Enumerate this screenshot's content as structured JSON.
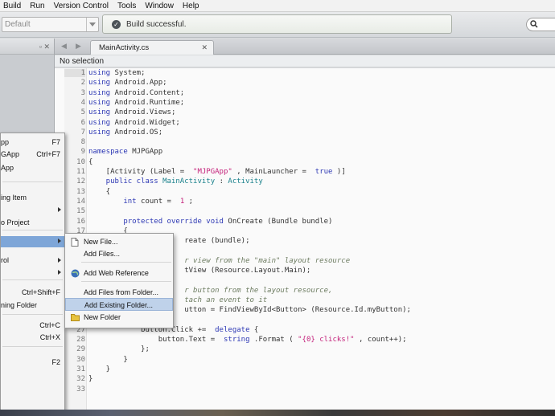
{
  "menubar": {
    "items": [
      "Build",
      "Run",
      "Version Control",
      "Tools",
      "Window",
      "Help"
    ]
  },
  "toolbar": {
    "config_value": "Default",
    "status_text": "Build successful."
  },
  "tabs": {
    "active_file": "MainActivity.cs"
  },
  "selection_bar": {
    "text": "No selection"
  },
  "editor": {
    "lines": [
      {
        "n": "1",
        "code": [
          [
            "kw",
            "using"
          ],
          [
            "",
            "System;"
          ]
        ]
      },
      {
        "n": "2",
        "code": [
          [
            "kw",
            "using"
          ],
          [
            "",
            "Android.App;"
          ]
        ]
      },
      {
        "n": "3",
        "code": [
          [
            "kw",
            "using"
          ],
          [
            "",
            "Android.Content;"
          ]
        ]
      },
      {
        "n": "4",
        "code": [
          [
            "kw",
            "using"
          ],
          [
            "",
            "Android.Runtime;"
          ]
        ]
      },
      {
        "n": "5",
        "code": [
          [
            "kw",
            "using"
          ],
          [
            "",
            "Android.Views;"
          ]
        ]
      },
      {
        "n": "6",
        "code": [
          [
            "kw",
            "using"
          ],
          [
            "",
            "Android.Widget;"
          ]
        ]
      },
      {
        "n": "7",
        "code": [
          [
            "kw",
            "using"
          ],
          [
            "",
            "Android.OS;"
          ]
        ]
      },
      {
        "n": "8",
        "code": []
      },
      {
        "n": "9",
        "code": [
          [
            "kw",
            "namespace"
          ],
          [
            "",
            "MJPGApp"
          ]
        ]
      },
      {
        "n": "10",
        "code": [
          [
            "",
            "{"
          ]
        ]
      },
      {
        "n": "11",
        "code": [
          [
            "",
            "    [Activity (Label = "
          ],
          [
            "str",
            "\"MJPGApp\""
          ],
          [
            "",
            ", MainLauncher = "
          ],
          [
            "kw",
            "true"
          ],
          [
            "",
            ")]"
          ]
        ]
      },
      {
        "n": "12",
        "code": [
          [
            "kw",
            "    public class"
          ],
          [
            "ty",
            "MainActivity"
          ],
          [
            "",
            ":"
          ],
          [
            "ty",
            "Activity"
          ]
        ]
      },
      {
        "n": "13",
        "code": [
          [
            "",
            "    {"
          ]
        ]
      },
      {
        "n": "14",
        "code": [
          [
            "kw",
            "        int"
          ],
          [
            "",
            "count = "
          ],
          [
            "str",
            "1"
          ],
          [
            "",
            ";"
          ]
        ]
      },
      {
        "n": "15",
        "code": []
      },
      {
        "n": "16",
        "code": [
          [
            "kw",
            "        protected override void"
          ],
          [
            "",
            "OnCreate (Bundle bundle)"
          ]
        ]
      },
      {
        "n": "17",
        "code": [
          [
            "",
            "        {"
          ]
        ]
      },
      {
        "n": "18",
        "code": [
          [
            "",
            "                      reate (bundle);"
          ]
        ]
      },
      {
        "n": "19",
        "code": []
      },
      {
        "n": "20",
        "code": [
          [
            "cm",
            "                      r view from the \"main\" layout resource"
          ]
        ]
      },
      {
        "n": "21",
        "code": [
          [
            "",
            "                      tView (Resource.Layout.Main);"
          ]
        ]
      },
      {
        "n": "22",
        "code": []
      },
      {
        "n": "23",
        "code": [
          [
            "cm",
            "                      r button from the layout resource,"
          ]
        ]
      },
      {
        "n": "24",
        "code": [
          [
            "cm",
            "                      tach an event to it"
          ]
        ]
      },
      {
        "n": "25",
        "code": [
          [
            "",
            "                      utton = FindViewById<Button> (Resource.Id.myButton);"
          ]
        ]
      },
      {
        "n": "26",
        "code": []
      },
      {
        "n": "27",
        "code": [
          [
            "",
            "            button.Click += "
          ],
          [
            "kw",
            "delegate"
          ],
          [
            "",
            "{"
          ]
        ]
      },
      {
        "n": "28",
        "code": [
          [
            "",
            "                button.Text = "
          ],
          [
            "kw",
            "string"
          ],
          [
            "",
            ".Format ("
          ],
          [
            "str",
            "\"{0} clicks!\""
          ],
          [
            "",
            ", count++);"
          ]
        ]
      },
      {
        "n": "29",
        "code": [
          [
            "",
            "            };"
          ]
        ]
      },
      {
        "n": "30",
        "code": [
          [
            "",
            "        }"
          ]
        ]
      },
      {
        "n": "31",
        "code": [
          [
            "",
            "    }"
          ]
        ]
      },
      {
        "n": "32",
        "code": [
          [
            "",
            "}"
          ]
        ]
      },
      {
        "n": "33",
        "code": []
      }
    ]
  },
  "context_menu": {
    "items": [
      {
        "label": "pp",
        "shortcut": "F7",
        "submenu": false
      },
      {
        "label": "GApp",
        "shortcut": "Ctrl+F7",
        "submenu": false
      },
      {
        "label": "App",
        "shortcut": "",
        "submenu": false
      },
      {
        "label": "ing Item",
        "shortcut": "",
        "submenu": false
      },
      {
        "label": "",
        "shortcut": "",
        "submenu": true
      },
      {
        "label": "o Project",
        "shortcut": "",
        "submenu": false
      },
      {
        "label": "",
        "shortcut": "",
        "submenu": true
      },
      {
        "label": "rol",
        "shortcut": "",
        "submenu": true
      },
      {
        "label": "",
        "shortcut": "",
        "submenu": true
      },
      {
        "label": "",
        "shortcut": "Ctrl+Shift+F",
        "submenu": false
      },
      {
        "label": "ning Folder",
        "shortcut": "",
        "submenu": false
      },
      {
        "label": "",
        "shortcut": "Ctrl+C",
        "submenu": false
      },
      {
        "label": "",
        "shortcut": "Ctrl+X",
        "submenu": false
      },
      {
        "label": "",
        "shortcut": "F2",
        "submenu": false
      }
    ]
  },
  "submenu": {
    "items": [
      {
        "label": "New File...",
        "icon": "file-icon"
      },
      {
        "label": "Add Files...",
        "icon": ""
      },
      {
        "label": "Add Web Reference",
        "icon": "globe-icon"
      },
      {
        "label": "Add Files from Folder...",
        "icon": ""
      },
      {
        "label": "Add Existing Folder...",
        "icon": ""
      },
      {
        "label": "New Folder",
        "icon": "folder-icon"
      }
    ],
    "highlighted_item": "Add Existing Folder..."
  },
  "colors": {
    "keyword": "#2d38b4",
    "string": "#c4227b",
    "type": "#19808b",
    "comment": "#6d7c61",
    "menu_highlight": "#7ea6d8"
  }
}
